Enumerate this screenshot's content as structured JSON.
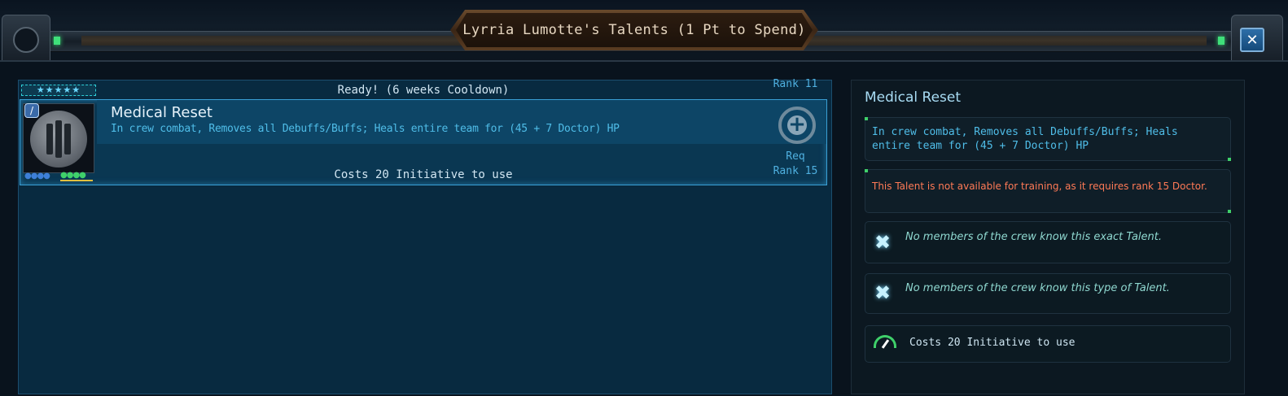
{
  "window": {
    "title": "Lyrria Lumotte's Talents (1 Pt to Spend)",
    "close_icon": "close-x-icon"
  },
  "talent_list": {
    "stars": "★★★★★",
    "status": "Ready! (6 weeks Cooldown)",
    "rank_top": "Rank 11",
    "item": {
      "name": "Medical Reset",
      "description": "In crew combat, Removes all Debuffs/Buffs; Heals entire team for (45 + 7 Doctor) HP",
      "cost": "Costs 20 Initiative to use",
      "req_line1": "Req",
      "req_line2": "Rank 15",
      "portrait_icon": "helmet-emblem-icon",
      "type_icon": "medical-cross-icon",
      "blue_dots": "●●●●",
      "green_dots": "●●●●"
    }
  },
  "detail": {
    "title": "Medical Reset",
    "description": "In crew combat, Removes all Debuffs/Buffs; Heals entire team for (45 + 7 Doctor) HP",
    "warning": "This Talent is not available for training, as it requires rank 15 Doctor.",
    "note_exact": "No members of the crew know this exact Talent.",
    "note_type": "No members of the crew know this type of Talent.",
    "cost": "Costs 20 Initiative to use"
  },
  "colors": {
    "accent_blue": "#4fbde8",
    "warning": "#ff7a56",
    "highlight_border": "#3aa0d6"
  }
}
